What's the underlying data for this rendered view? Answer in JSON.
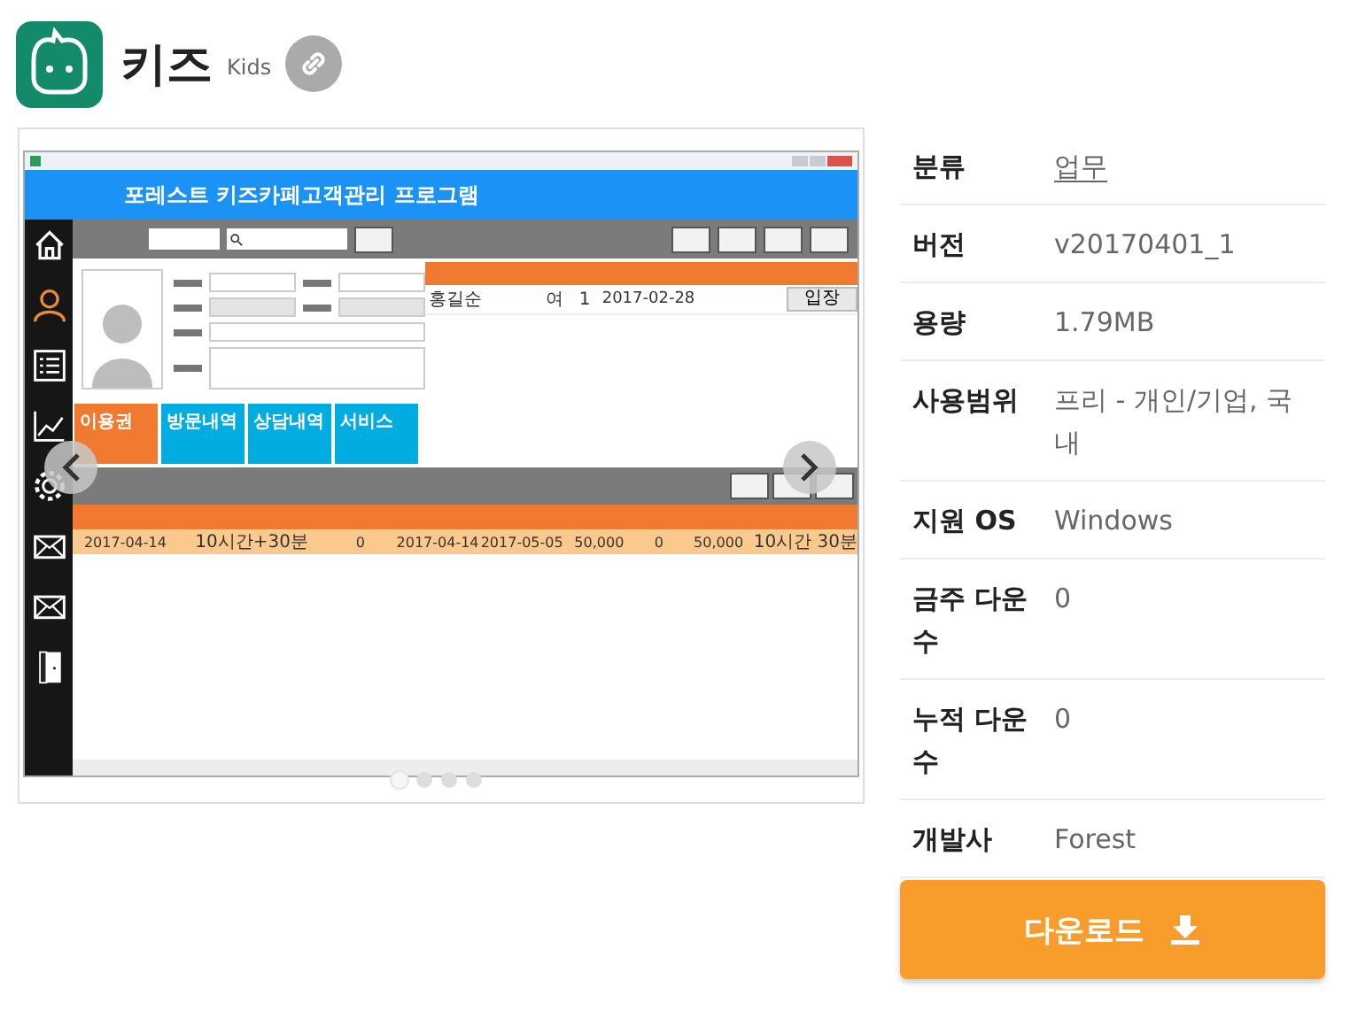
{
  "header": {
    "title": "키즈",
    "subtitle": "Kids"
  },
  "gallery": {
    "screenshot": {
      "banner_title": "포레스트 키즈카페고객관리 프로그램",
      "customer_row": [
        "홍길순",
        "여",
        "1",
        "2017-02-28"
      ],
      "customer_row_button": "입장",
      "tiles": [
        {
          "label": "이용권",
          "kind": "active"
        },
        {
          "label": "방문내역",
          "kind": "normal"
        },
        {
          "label": "상담내역",
          "kind": "normal"
        },
        {
          "label": "서비스",
          "kind": "normal"
        }
      ],
      "ticket_row": [
        "2017-04-14",
        "10시간+30분",
        "0",
        "2017-04-14",
        "2017-05-05",
        "50,000",
        "0",
        "50,000",
        "10시간 30분"
      ]
    },
    "slides": [
      {
        "selected": true
      },
      {
        "selected": false
      },
      {
        "selected": false
      },
      {
        "selected": false
      }
    ]
  },
  "info": [
    {
      "label": "분류",
      "value": "업무",
      "kind": "link"
    },
    {
      "label": "버전",
      "value": "v20170401_1",
      "kind": "text"
    },
    {
      "label": "용량",
      "value": "1.79MB",
      "kind": "text"
    },
    {
      "label": "사용범위",
      "value": "프리 - 개인/기업, 국내",
      "kind": "text"
    },
    {
      "label": "지원 OS",
      "value": "Windows",
      "kind": "text"
    },
    {
      "label": "금주 다운수",
      "value": "0",
      "kind": "text"
    },
    {
      "label": "누적 다운수",
      "value": "0",
      "kind": "text"
    },
    {
      "label": "개발사",
      "value": "Forest",
      "kind": "text"
    }
  ],
  "download_button": "다운로드"
}
